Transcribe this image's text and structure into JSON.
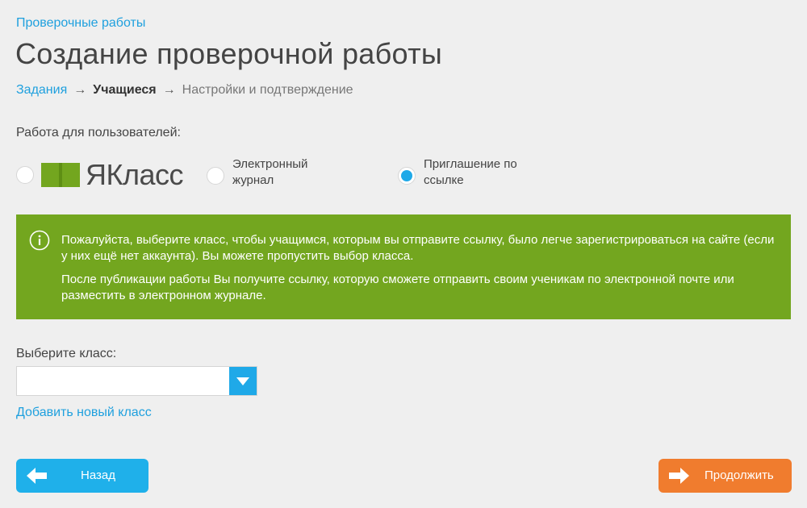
{
  "breadcrumb": {
    "parent": "Проверочные работы"
  },
  "page": {
    "title": "Создание проверочной работы"
  },
  "steps": [
    {
      "label": "Задания"
    },
    {
      "label": "Учащиеся"
    },
    {
      "label": "Настройки и подтверждение"
    }
  ],
  "users": {
    "label": "Работа для пользователей:",
    "options": [
      {
        "label": "ЯКласс",
        "checked": false
      },
      {
        "label_line1": "Электронный",
        "label_line2": "журнал",
        "checked": false
      },
      {
        "label_line1": "Приглашение по",
        "label_line2": "ссылке",
        "checked": true
      }
    ]
  },
  "info": {
    "paragraph1": "Пожалуйста, выберите класс, чтобы учащимся, которым вы отправите ссылку, было легче зарегистрироваться на сайте (если у них ещё нет аккаунта). Вы можете пропустить выбор класса.",
    "paragraph2": "После публикации работы Вы получите ссылку, которую сможете отправить своим ученикам по электронной почте или разместить в электронном журнале."
  },
  "class_select": {
    "label": "Выберите класс:",
    "value": ""
  },
  "add_class_link": "Добавить новый класс",
  "buttons": {
    "back": "Назад",
    "next": "Продолжить"
  },
  "colors": {
    "link": "#1fa0de",
    "info_bg": "#73a61f",
    "back_button": "#1fb0ea",
    "next_button": "#f07c2e",
    "logo_green": "#73a61f"
  }
}
